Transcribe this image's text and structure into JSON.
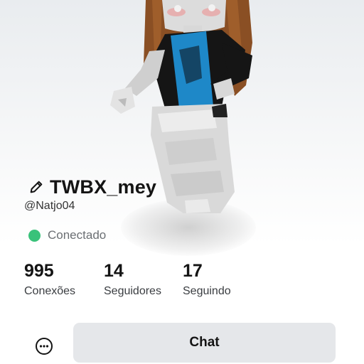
{
  "profile": {
    "display_name": "TWBX_mey",
    "username": "@Natjo04",
    "status_text": "Conectado",
    "status_color": "#39c27a"
  },
  "stats": [
    {
      "value": "995",
      "label": "Conexões"
    },
    {
      "value": "14",
      "label": "Seguidores"
    },
    {
      "value": "17",
      "label": "Seguindo"
    }
  ],
  "actions": {
    "chat_label": "Chat",
    "more_icon": "more-horizontal-icon",
    "edit_icon": "pencil-icon"
  }
}
